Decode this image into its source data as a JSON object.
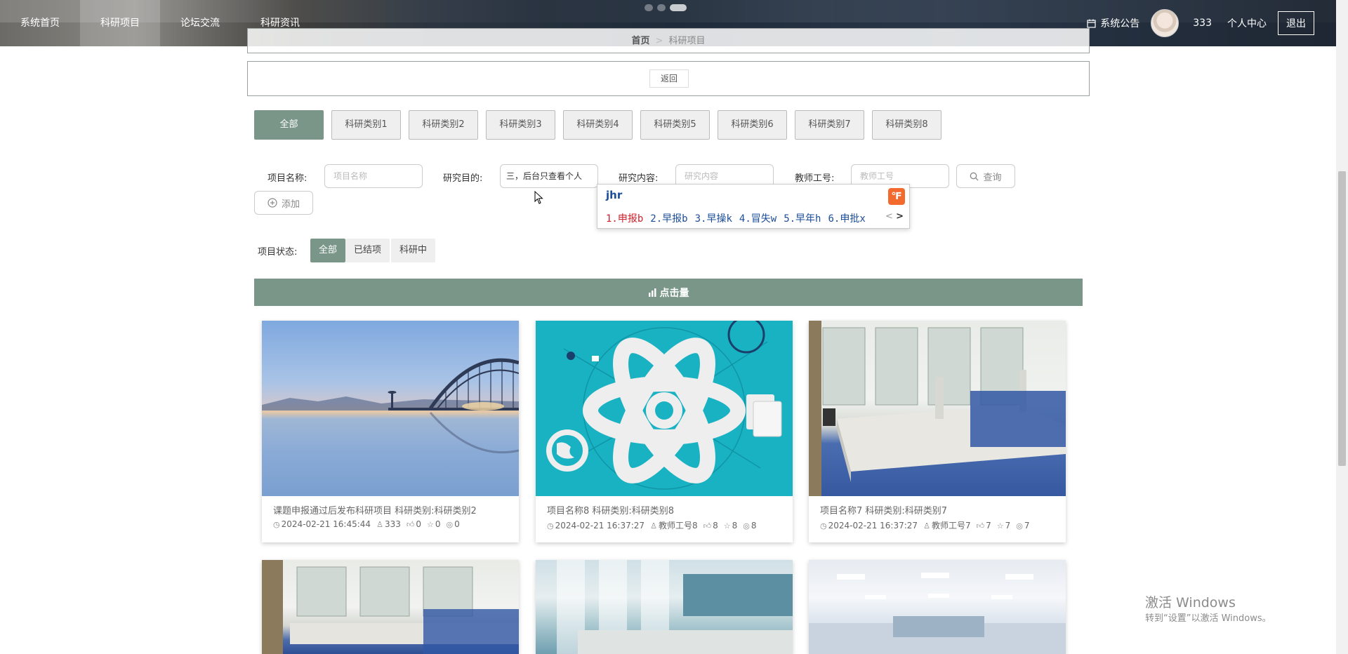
{
  "header": {
    "nav": [
      "系统首页",
      "科研项目",
      "论坛交流",
      "科研资讯"
    ],
    "active_nav": "科研项目",
    "notice": "系统公告",
    "username": "333",
    "personal_center": "个人中心",
    "logout": "退出"
  },
  "breadcrumb": {
    "home": "首页",
    "separator": ">",
    "current": "科研项目"
  },
  "back_button": "返回",
  "categories": [
    "全部",
    "科研类别1",
    "科研类别2",
    "科研类别3",
    "科研类别4",
    "科研类别5",
    "科研类别6",
    "科研类别7",
    "科研类别8"
  ],
  "filters": {
    "project_name_label": "项目名称:",
    "project_name_placeholder": "项目名称",
    "purpose_label": "研究目的:",
    "purpose_value": "三，后台只查看个人",
    "content_label": "研究内容:",
    "content_placeholder": "研究内容",
    "teacher_label": "教师工号:",
    "teacher_placeholder": "教师工号",
    "query_button": "查询",
    "add_button": "添加"
  },
  "ime": {
    "composition": "jhr",
    "candidates": [
      "1.申报b",
      "2.早报b",
      "3.早操k",
      "4.冒失w",
      "5.早年h",
      "6.申批x"
    ],
    "prev": "<",
    "next": ">"
  },
  "status": {
    "label": "项目状态:",
    "tabs": [
      "全部",
      "已结项",
      "科研中"
    ]
  },
  "sort_bar": "点击量",
  "cards": [
    {
      "title": "课题申报通过后发布科研项目   科研类别:科研类别2",
      "date": "2024-02-21 16:45:44",
      "author": "333",
      "likes": "0",
      "favs": "0",
      "views": "0",
      "image": "lake-bridge"
    },
    {
      "title": "项目名称8   科研类别:科研类别8",
      "date": "2024-02-21 16:37:27",
      "author": "教师工号8",
      "likes": "8",
      "favs": "8",
      "views": "8",
      "image": "atom-illustration"
    },
    {
      "title": "项目名称7   科研类别:科研类别7",
      "date": "2024-02-21 16:37:27",
      "author": "教师工号7",
      "likes": "7",
      "favs": "7",
      "views": "7",
      "image": "laboratory"
    }
  ],
  "watermark": {
    "line1": "激活 Windows",
    "line2": "转到“设置”以激活 Windows。"
  },
  "colors": {
    "accent": "#7a9688",
    "ime_blue": "#1b4d9a",
    "ime_red": "#d0202a",
    "ime_logo": "#f26a2e"
  }
}
